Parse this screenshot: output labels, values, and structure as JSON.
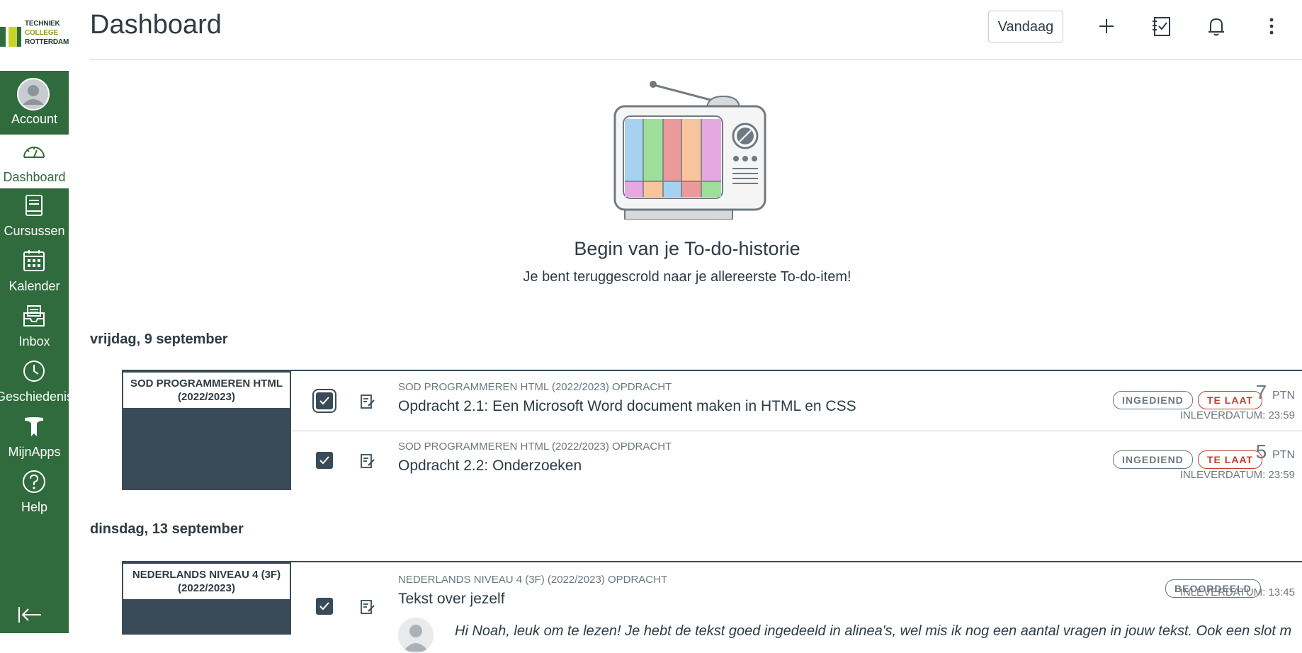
{
  "logo": {
    "line1": "TECHNIEK",
    "line2": "COLLEGE",
    "line3": "ROTTERDAM"
  },
  "nav": [
    {
      "label": "Account",
      "icon": "account-avatar-icon"
    },
    {
      "label": "Dashboard",
      "icon": "dashboard-gauge-icon"
    },
    {
      "label": "Cursussen",
      "icon": "courses-book-icon"
    },
    {
      "label": "Kalender",
      "icon": "calendar-icon"
    },
    {
      "label": "Inbox",
      "icon": "inbox-icon"
    },
    {
      "label": "Geschiedenis",
      "icon": "history-clock-icon"
    },
    {
      "label": "MijnApps",
      "icon": "mijnapps-icon"
    },
    {
      "label": "Help",
      "icon": "help-icon"
    }
  ],
  "header": {
    "title": "Dashboard",
    "today_label": "Vandaag"
  },
  "history": {
    "title": "Begin van je To-do-historie",
    "subtitle": "Je bent teruggescrold naar je allereerste To-do-item!"
  },
  "days": [
    {
      "date": "vrijdag, 9 september",
      "course": "SOD PROGRAMMEREN HTML (2022/2023)",
      "items": [
        {
          "context": "SOD PROGRAMMEREN HTML (2022/2023) OPDRACHT",
          "title": "Opdracht 2.1: Een Microsoft Word document maken in HTML en CSS",
          "badge1": "INGEDIEND",
          "badge2": "TE LAAT",
          "points": "7",
          "points_unit": "PTN",
          "due": "INLEVERDATUM: 23:59"
        },
        {
          "context": "SOD PROGRAMMEREN HTML (2022/2023) OPDRACHT",
          "title": "Opdracht 2.2: Onderzoeken",
          "badge1": "INGEDIEND",
          "badge2": "TE LAAT",
          "points": "5",
          "points_unit": "PTN",
          "due": "INLEVERDATUM: 23:59"
        }
      ]
    },
    {
      "date": "dinsdag, 13 september",
      "course": "NEDERLANDS NIVEAU 4 (3F) (2022/2023)",
      "items": [
        {
          "context": "NEDERLANDS NIVEAU 4 (3F) (2022/2023) OPDRACHT",
          "title": "Tekst over jezelf",
          "badge1": "BEOORDEELD",
          "due": "INLEVERDATUM: 13:45",
          "comment": "Hi Noah, leuk om te lezen! Je hebt de tekst goed ingedeeld in alinea's, wel mis ik nog een aantal vragen in jouw tekst. Ook een slot mist. Kijk ..."
        }
      ]
    }
  ],
  "colors": {
    "sidebar": "#2f6b3c",
    "course_card": "#394b58",
    "late": "#c23c2d",
    "text": "#2d3b45"
  }
}
